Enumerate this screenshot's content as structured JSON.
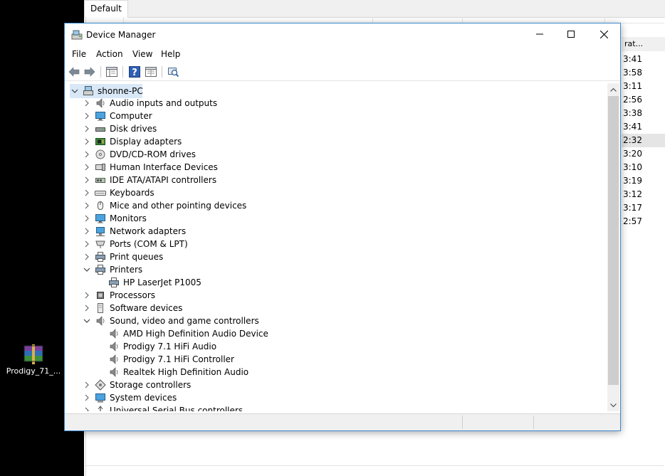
{
  "desktop": {
    "icon_name": "winrar-archive-icon",
    "icon_label": "Prodigy_71_..."
  },
  "background_window": {
    "tab_label": "Default",
    "column_header": "rat...",
    "times": [
      "3:41",
      "3:58",
      "3:11",
      "2:56",
      "3:38",
      "3:41",
      "2:32",
      "3:20",
      "3:10",
      "3:19",
      "3:12",
      "3:17",
      "2:57"
    ],
    "selected_index": 6
  },
  "window": {
    "title": "Device Manager",
    "icon": "device-manager-icon"
  },
  "menu": {
    "file": "File",
    "action": "Action",
    "view": "View",
    "help": "Help"
  },
  "toolbar": {
    "icons": [
      "back-arrow-icon",
      "forward-arrow-icon",
      "show-hide-console-tree-icon",
      "help-icon",
      "properties-icon",
      "scan-hardware-icon"
    ]
  },
  "tree": {
    "root": "shonne-PC",
    "categories": [
      {
        "label": "Audio inputs and outputs",
        "icon": "speaker-icon",
        "expanded": false
      },
      {
        "label": "Computer",
        "icon": "monitor-icon",
        "expanded": false
      },
      {
        "label": "Disk drives",
        "icon": "disk-drive-icon",
        "expanded": false
      },
      {
        "label": "Display adapters",
        "icon": "display-adapter-icon",
        "expanded": false
      },
      {
        "label": "DVD/CD-ROM drives",
        "icon": "dvd-drive-icon",
        "expanded": false
      },
      {
        "label": "Human Interface Devices",
        "icon": "hid-icon",
        "expanded": false
      },
      {
        "label": "IDE ATA/ATAPI controllers",
        "icon": "ide-controller-icon",
        "expanded": false
      },
      {
        "label": "Keyboards",
        "icon": "keyboard-icon",
        "expanded": false
      },
      {
        "label": "Mice and other pointing devices",
        "icon": "mouse-icon",
        "expanded": false
      },
      {
        "label": "Monitors",
        "icon": "monitor-icon",
        "expanded": false
      },
      {
        "label": "Network adapters",
        "icon": "network-adapter-icon",
        "expanded": false
      },
      {
        "label": "Ports (COM & LPT)",
        "icon": "port-icon",
        "expanded": false
      },
      {
        "label": "Print queues",
        "icon": "printer-icon",
        "expanded": false
      },
      {
        "label": "Printers",
        "icon": "printer-icon",
        "expanded": true,
        "children": [
          "HP LaserJet P1005"
        ]
      },
      {
        "label": "Processors",
        "icon": "processor-icon",
        "expanded": false
      },
      {
        "label": "Software devices",
        "icon": "software-device-icon",
        "expanded": false
      },
      {
        "label": "Sound, video and game controllers",
        "icon": "speaker-icon",
        "expanded": true,
        "children": [
          "AMD High Definition Audio Device",
          "Prodigy 7.1 HiFi Audio",
          "Prodigy 7.1 HiFi Controller",
          "Realtek High Definition Audio"
        ]
      },
      {
        "label": "Storage controllers",
        "icon": "storage-controller-icon",
        "expanded": false
      },
      {
        "label": "System devices",
        "icon": "system-device-icon",
        "expanded": false
      },
      {
        "label": "Universal Serial Bus controllers",
        "icon": "usb-icon",
        "expanded": false
      }
    ]
  },
  "colors": {
    "window_border": "#3c88cf",
    "selection": "#d9e8f7",
    "desktop": "#000000"
  }
}
